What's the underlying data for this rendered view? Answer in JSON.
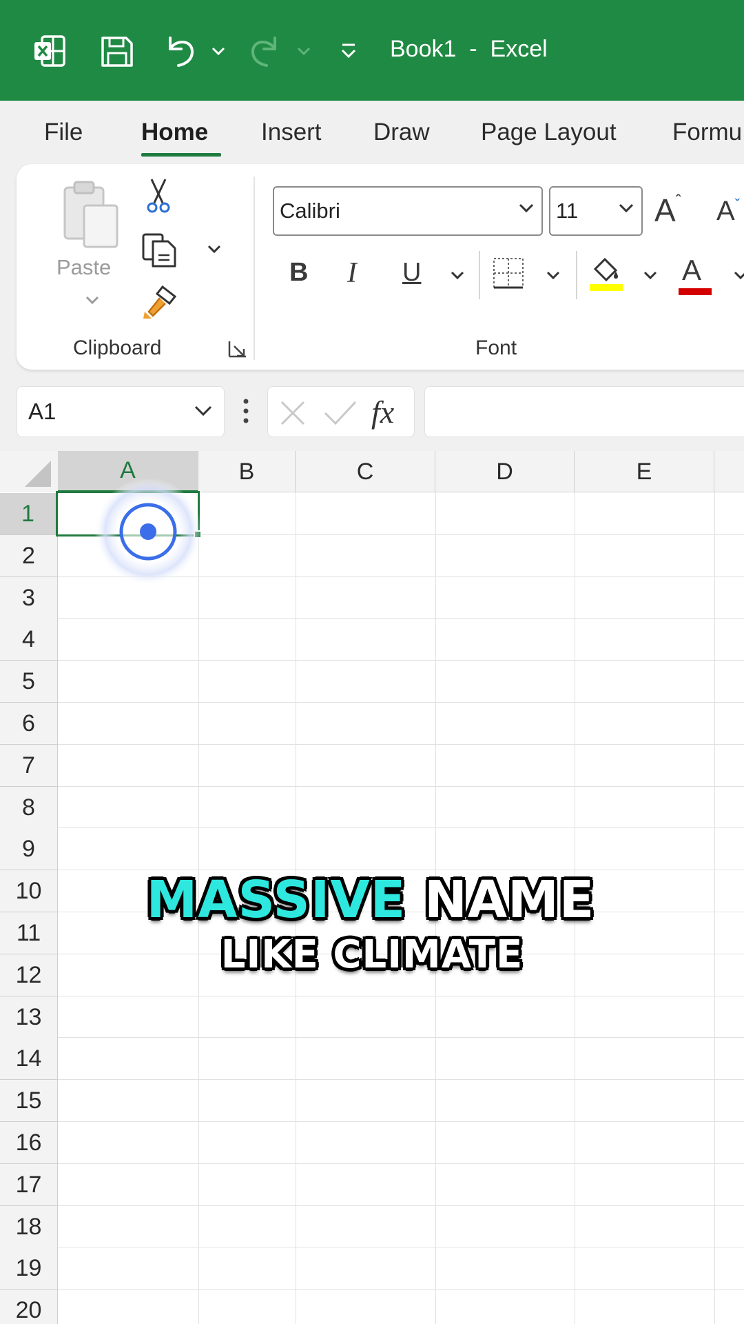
{
  "titlebar": {
    "title": "Book1  -  Excel",
    "icons": [
      "excel-logo-icon",
      "save-icon",
      "undo-icon",
      "redo-icon",
      "customize-quick-access-icon"
    ]
  },
  "menu": {
    "tabs": [
      "File",
      "Home",
      "Insert",
      "Draw",
      "Page Layout",
      "Formu"
    ],
    "active": "Home"
  },
  "ribbon": {
    "clipboard": {
      "paste_label": "Paste",
      "group_label": "Clipboard"
    },
    "font": {
      "font_name": "Calibri",
      "font_size": "11",
      "bold": "B",
      "italic": "I",
      "underline": "U",
      "grow_font": "A",
      "shrink_font": "A",
      "font_color_glyph": "A",
      "fill_color": "#ffff00",
      "font_color": "#d40000",
      "group_label": "Font"
    }
  },
  "formula_bar": {
    "name_box": "A1",
    "fx": "fx",
    "value": ""
  },
  "grid": {
    "columns": [
      "A",
      "B",
      "C",
      "D",
      "E"
    ],
    "rows": [
      "1",
      "2",
      "3",
      "4",
      "5",
      "6",
      "7",
      "8",
      "9",
      "10",
      "11",
      "12",
      "13",
      "14",
      "15",
      "16",
      "17",
      "18",
      "19",
      "20"
    ],
    "selected_cell": "A1"
  },
  "caption": {
    "line1_highlight": "MASSIVE",
    "line1_rest": " NAME",
    "line2": "LIKE CLIMATE"
  },
  "colors": {
    "excel_green": "#1f8a43",
    "selection_green": "#1f7a3f",
    "caption_highlight": "#2ee8df",
    "tap_blue": "#3b6ee8"
  }
}
